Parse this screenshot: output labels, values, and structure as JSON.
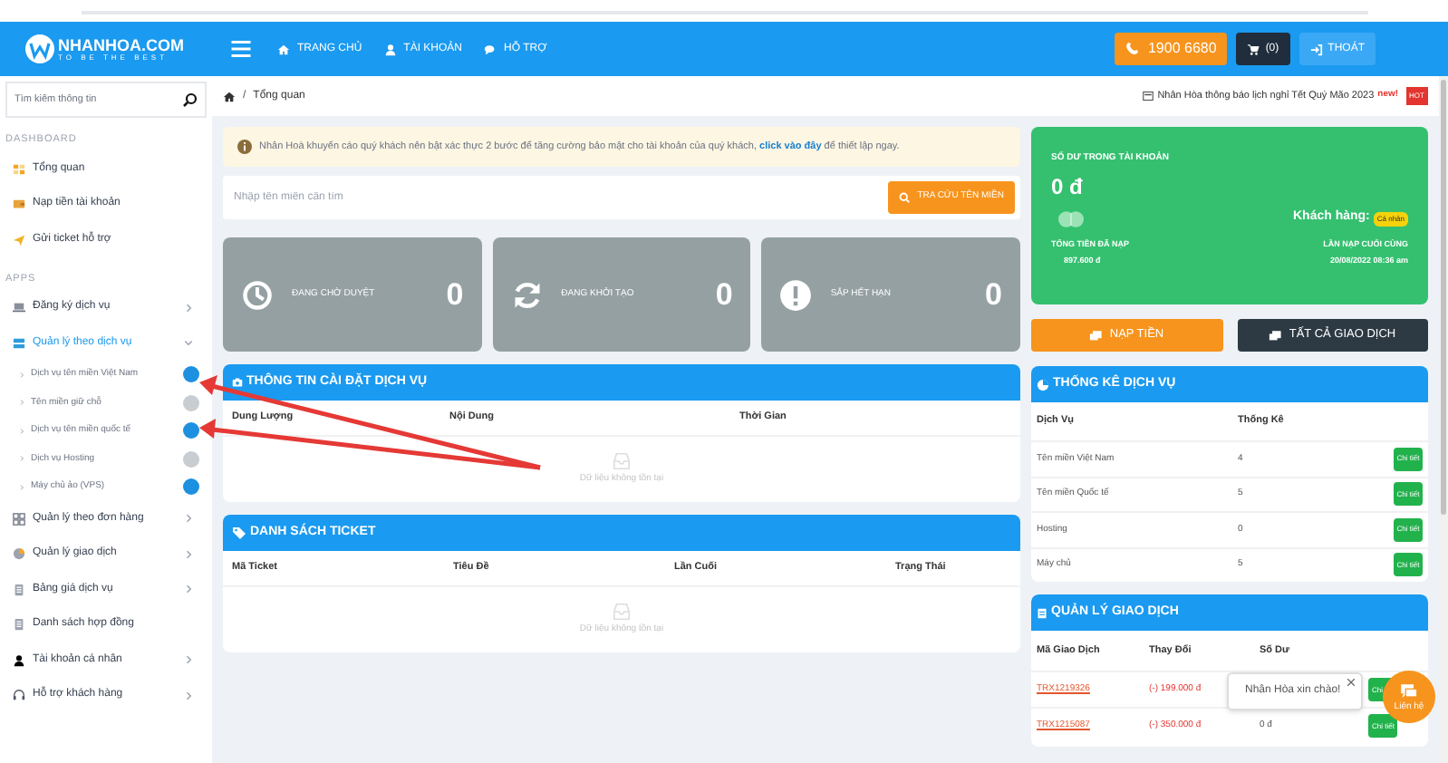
{
  "header": {
    "logo_name": "NHANHOA.COM",
    "logo_tagline": "TO BE THE BEST",
    "nav": [
      {
        "label": "TRANG CHỦ"
      },
      {
        "label": "TÀI KHOẢN"
      },
      {
        "label": "HỖ TRỢ"
      }
    ],
    "phone": "1900 6680",
    "cart": "(0)",
    "logout": "THOÁT"
  },
  "sidebar": {
    "search": {
      "placeholder": "Tìm kiếm thông tin"
    },
    "sections": [
      {
        "title": "DASHBOARD",
        "items": [
          {
            "label": "Tổng quan",
            "chevron": false,
            "selected": false
          },
          {
            "label": "Nạp tiền tài khoản",
            "chevron": false,
            "selected": false
          },
          {
            "label": "Gửi ticket hỗ trợ",
            "chevron": false,
            "selected": false
          }
        ]
      },
      {
        "title": "APPS",
        "items": [
          {
            "label": "Đăng ký dịch vụ",
            "chevron": true,
            "selected": false
          },
          {
            "label": "Quản lý theo dịch vụ",
            "chevron": true,
            "selected": true,
            "expanded": true,
            "children": [
              {
                "label": "Dịch vụ tên miền Việt Nam",
                "color": "#1e90e0"
              },
              {
                "label": "Tên miền giữ chỗ",
                "color": "#c8cdd2"
              },
              {
                "label": "Dịch vụ tên miền quốc tế",
                "color": "#1e90e0"
              },
              {
                "label": "Dịch vụ Hosting",
                "color": "#c8cdd2"
              },
              {
                "label": "Máy chủ ảo (VPS)",
                "color": "#1e90e0"
              }
            ]
          },
          {
            "label": "Quản lý theo đơn hàng",
            "chevron": true,
            "selected": false
          },
          {
            "label": "Quản lý giao dịch",
            "chevron": true,
            "selected": false
          },
          {
            "label": "Bảng giá dịch vụ",
            "chevron": true,
            "selected": false
          },
          {
            "label": "Danh sách hợp đồng",
            "chevron": false,
            "selected": false
          },
          {
            "label": "Tài khoản cá nhân",
            "chevron": true,
            "selected": false
          },
          {
            "label": "Hỗ trợ khách hàng",
            "chevron": true,
            "selected": false
          }
        ]
      }
    ]
  },
  "breadcrumb": {
    "separator": "/",
    "current": "Tổng quan"
  },
  "announcement": {
    "text": "Nhân Hòa thông báo lịch nghỉ Tết Quý Mão 2023",
    "new_tag": "new!",
    "hot_badge": "HOT"
  },
  "alert": {
    "text": "Nhân Hoà khuyến cáo quý khách nên bật xác thực 2 bước để tăng cường bảo mật cho tài khoản của quý khách, **click vào đây** để thiết lập ngay."
  },
  "domain_search": {
    "placeholder": "Nhập tên miền cần tìm",
    "button": "TRA CỨU TÊN MIỀN"
  },
  "stats": [
    {
      "label": "ĐANG CHỜ DUYỆT",
      "value": "0"
    },
    {
      "label": "ĐANG KHỞI TẠO",
      "value": "0"
    },
    {
      "label": "SẮP HẾT HẠN",
      "value": "0"
    }
  ],
  "service_info": {
    "title": "THÔNG TIN CÀI ĐẶT DỊCH VỤ",
    "columns": [
      "Dung Lượng",
      "Nội Dung",
      "Thời Gian"
    ],
    "empty": "Dữ liệu không tồn tại"
  },
  "tickets": {
    "title": "DANH SÁCH TICKET",
    "columns": [
      "Mã Ticket",
      "Tiêu Đề",
      "Lần Cuối",
      "Trạng Thái"
    ],
    "empty": "Dữ liệu không tồn tại"
  },
  "balance": {
    "title": "SỐ DƯ TRONG TÀI KHOẢN",
    "amount": "0 đ",
    "customer_label": "Khách hàng:",
    "customer_type": "Cá nhân",
    "total_label": "TỔNG TIỀN ĐÃ NẠP",
    "total": "897.600 đ",
    "last_label": "LẦN NẠP CUỐI CÙNG",
    "last": "20/08/2022 08:36 am"
  },
  "actions": [
    {
      "label": "NẠP TIỀN",
      "kind": "primary"
    },
    {
      "label": "TẤT CẢ GIAO DỊCH",
      "kind": "dark"
    }
  ],
  "service_stats": {
    "title": "THỐNG KÊ DỊCH VỤ",
    "columns": [
      "Dịch Vụ",
      "Thống Kê"
    ],
    "rows": [
      {
        "service": "Tên miền Việt Nam",
        "count": "4",
        "button": "Chi tiết"
      },
      {
        "service": "Tên miền Quốc tế",
        "count": "5",
        "button": "Chi tiết"
      },
      {
        "service": "Hosting",
        "count": "0",
        "button": "Chi tiết"
      },
      {
        "service": "Máy chủ",
        "count": "5",
        "button": "Chi tiết"
      }
    ]
  },
  "transactions": {
    "title": "QUẢN LÝ GIAO DỊCH",
    "columns": [
      "Mã Giao Dịch",
      "Thay Đổi",
      "Số Dư"
    ],
    "rows": [
      {
        "id": "TRX1219326",
        "change": "(-) 199.000 đ",
        "button": "Chi"
      },
      {
        "id": "TRX1215087",
        "change": "(-) 350.000 đ",
        "balance": "0 đ",
        "button": "Chi tiết"
      }
    ]
  },
  "chat": {
    "greeting": "Nhân Hòa xin chào!",
    "button": "Liên hệ"
  }
}
